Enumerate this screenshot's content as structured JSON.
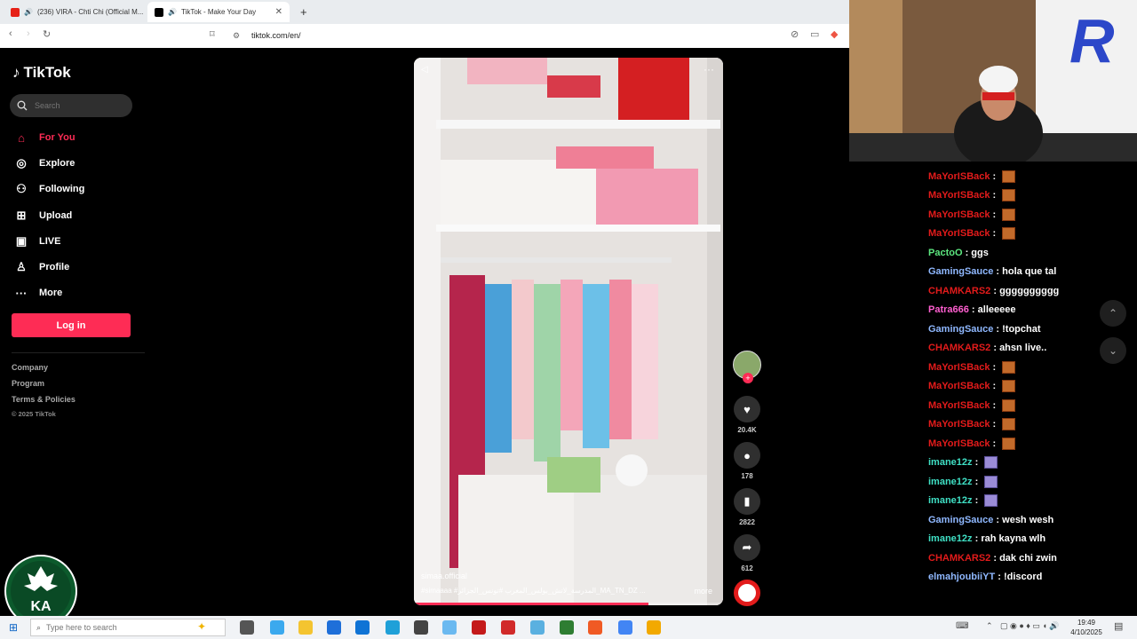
{
  "browser": {
    "tabs": [
      {
        "title": "(236) VIRA - Chti Chi (Official M...",
        "active": false
      },
      {
        "title": "TikTok - Make Your Day",
        "active": true
      }
    ],
    "url": "tiktok.com/en/"
  },
  "sidebar": {
    "brand": "TikTok",
    "search_placeholder": "Search",
    "nav": [
      {
        "label": "For You",
        "icon": "home-icon",
        "active": true
      },
      {
        "label": "Explore",
        "icon": "compass-icon"
      },
      {
        "label": "Following",
        "icon": "following-icon"
      },
      {
        "label": "Upload",
        "icon": "upload-icon"
      },
      {
        "label": "LIVE",
        "icon": "live-icon"
      },
      {
        "label": "Profile",
        "icon": "profile-icon"
      },
      {
        "label": "More",
        "icon": "more-icon"
      }
    ],
    "login_label": "Log in",
    "footer": [
      "Company",
      "Program",
      "Terms & Policies"
    ],
    "copyright": "© 2025 TikTok"
  },
  "video": {
    "author": "simaa.official",
    "tags": "#simaaaa #المدرسة_لاتش_بولس_المغرب #تونس_الجزائر_MA_TN_DZ ...",
    "more_label": "more",
    "progress": 0.76
  },
  "actions": {
    "likes": "20.4K",
    "comments": "178",
    "saves": "2822",
    "shares": "612"
  },
  "chat": [
    {
      "user": "MaYorISBack",
      "color": "#e31b1b",
      "text": "",
      "emote": "orange"
    },
    {
      "user": "MaYorISBack",
      "color": "#e31b1b",
      "text": "",
      "emote": "orange"
    },
    {
      "user": "MaYorISBack",
      "color": "#e31b1b",
      "text": "",
      "emote": "orange"
    },
    {
      "user": "MaYorISBack",
      "color": "#e31b1b",
      "text": "",
      "emote": "orange"
    },
    {
      "user": "PactoO",
      "color": "#5ce67f",
      "text": "ggs",
      "emote": null
    },
    {
      "user": "GamingSauce",
      "color": "#8fb8ff",
      "text": "hola que tal",
      "emote": null
    },
    {
      "user": "CHAMKARS2",
      "color": "#e31b1b",
      "text": "gggggggggg",
      "emote": null
    },
    {
      "user": "Patra666",
      "color": "#ff5fd0",
      "text": "alleeeee",
      "emote": null
    },
    {
      "user": "GamingSauce",
      "color": "#8fb8ff",
      "text": "!topchat",
      "emote": null
    },
    {
      "user": "CHAMKARS2",
      "color": "#e31b1b",
      "text": "ahsn live..",
      "emote": null
    },
    {
      "user": "MaYorISBack",
      "color": "#e31b1b",
      "text": "",
      "emote": "orange"
    },
    {
      "user": "MaYorISBack",
      "color": "#e31b1b",
      "text": "",
      "emote": "orange"
    },
    {
      "user": "MaYorISBack",
      "color": "#e31b1b",
      "text": "",
      "emote": "orange"
    },
    {
      "user": "MaYorISBack",
      "color": "#e31b1b",
      "text": "",
      "emote": "orange"
    },
    {
      "user": "MaYorISBack",
      "color": "#e31b1b",
      "text": "",
      "emote": "orange"
    },
    {
      "user": "imane12z",
      "color": "#3fe0c5",
      "text": "",
      "emote": "purple"
    },
    {
      "user": "imane12z",
      "color": "#3fe0c5",
      "text": "",
      "emote": "purple"
    },
    {
      "user": "imane12z",
      "color": "#3fe0c5",
      "text": "",
      "emote": "purple"
    },
    {
      "user": "GamingSauce",
      "color": "#8fb8ff",
      "text": "wesh wesh",
      "emote": null
    },
    {
      "user": "imane12z",
      "color": "#3fe0c5",
      "text": "rah kayna wlh",
      "emote": null
    },
    {
      "user": "CHAMKARS2",
      "color": "#e31b1b",
      "text": "dak chi zwin",
      "emote": null
    },
    {
      "user": "elmahjoubiiYT",
      "color": "#8fb8ff",
      "text": "!discord",
      "emote": null
    }
  ],
  "taskbar": {
    "search_placeholder": "Type here to search",
    "time": "19:49",
    "date": "4/10/2025"
  },
  "colors": {
    "accent": "#fe2c55"
  }
}
